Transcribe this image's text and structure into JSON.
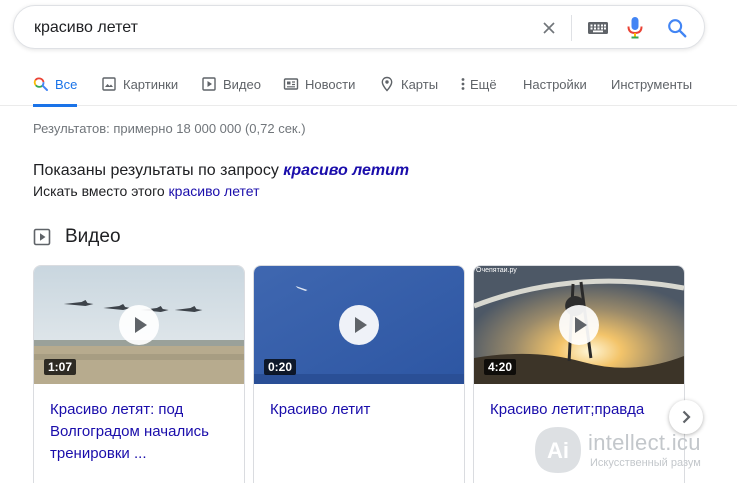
{
  "search": {
    "query": "красиво летет"
  },
  "tabs": [
    {
      "label": "Все",
      "icon": "search-icon",
      "active": true
    },
    {
      "label": "Картинки",
      "icon": "image-icon"
    },
    {
      "label": "Видео",
      "icon": "video-icon"
    },
    {
      "label": "Новости",
      "icon": "news-icon"
    },
    {
      "label": "Карты",
      "icon": "map-pin-icon"
    },
    {
      "label": "Ещё",
      "icon": "more-vert-icon"
    },
    {
      "label": "Настройки"
    },
    {
      "label": "Инструменты"
    }
  ],
  "stats": "Результатов: примерно 18 000 000 (0,72 сек.)",
  "spelling": {
    "shown_prefix": "Показаны результаты по запросу ",
    "corrected_query": "красиво летит",
    "instead_prefix": "Искать вместо этого ",
    "original_query": "красиво летет"
  },
  "video_section": {
    "title": "Видео",
    "cards": [
      {
        "duration": "1:07",
        "title": "Красиво летят: под Волгоградом начались тренировки ..."
      },
      {
        "duration": "0:20",
        "title": "Красиво летит"
      },
      {
        "duration": "4:20",
        "title": "Красиво летит;правда",
        "source_watermark": "Очепятаи.ру"
      }
    ]
  },
  "site_watermark": {
    "name": "intellect.icu",
    "tagline": "Искусственный разум",
    "logo_letters": "Ai"
  },
  "colors": {
    "accent": "#1a73e8",
    "link": "#1a0dab",
    "muted": "#70757a"
  }
}
